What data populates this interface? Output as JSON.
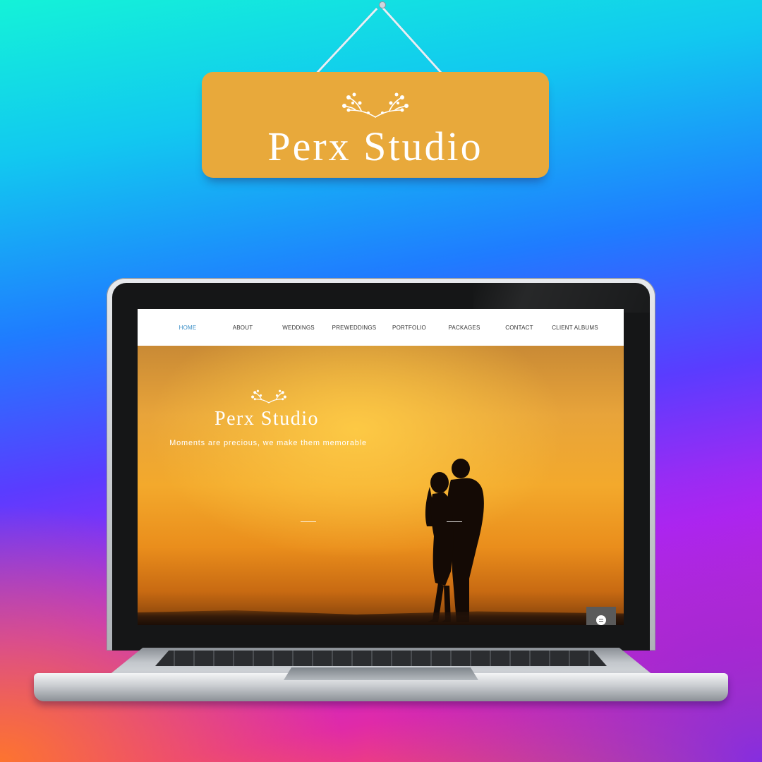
{
  "sign": {
    "title": "Perx Studio",
    "color": "#e8a93b"
  },
  "laptop": {
    "site": {
      "nav": [
        {
          "label": "HOME",
          "active": true
        },
        {
          "label": "ABOUT",
          "active": false
        },
        {
          "label": "WEDDINGS",
          "active": false
        },
        {
          "label": "PREWEDDINGS",
          "active": false
        },
        {
          "label": "PORTFOLIO",
          "active": false
        },
        {
          "label": "PACKAGES",
          "active": false
        },
        {
          "label": "CONTACT",
          "active": false
        },
        {
          "label": "CLIENT ALBUMS",
          "active": false
        }
      ],
      "hero": {
        "brand": "Perx Studio",
        "tagline": "Moments are precious, we make them memorable"
      },
      "chat_icon": "chat-icon",
      "accent": "#3b8fc7"
    }
  }
}
